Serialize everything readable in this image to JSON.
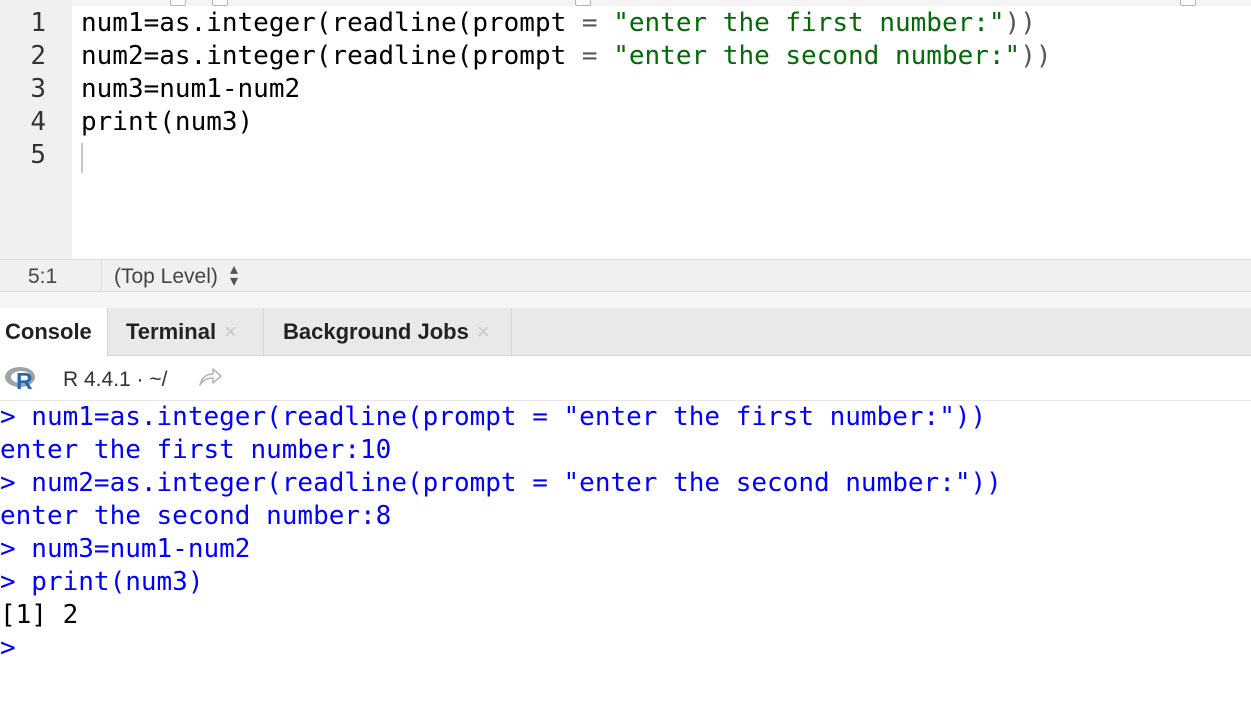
{
  "editor": {
    "line_numbers": [
      "1",
      "2",
      "3",
      "4",
      "5"
    ],
    "lines": [
      {
        "pre": "num1=as.integer(readline(prompt ",
        "eq": "=",
        "sp": " ",
        "str": "\"enter the first number:\"",
        "post": "))"
      },
      {
        "pre": "num2=as.integer(readline(prompt ",
        "eq": "=",
        "sp": " ",
        "str": "\"enter the second number:\"",
        "post": "))"
      },
      {
        "pre": "num3=num1-num2",
        "eq": "",
        "sp": "",
        "str": "",
        "post": ""
      },
      {
        "pre": "print(num3)",
        "eq": "",
        "sp": "",
        "str": "",
        "post": ""
      }
    ]
  },
  "statusbar": {
    "position": "5:1",
    "scope": "(Top Level)"
  },
  "tabs": {
    "console": "Console",
    "terminal": "Terminal",
    "background_jobs": "Background Jobs"
  },
  "console_header": {
    "r_version": "R 4.4.1 · ~/"
  },
  "console": {
    "lines": [
      {
        "text": "> num1=as.integer(readline(prompt = \"enter the first number:\"))",
        "kind": "cmd"
      },
      {
        "text": "enter the first number:10",
        "kind": "cmd"
      },
      {
        "text": "> num2=as.integer(readline(prompt = \"enter the second number:\"))",
        "kind": "cmd"
      },
      {
        "text": "enter the second number:8",
        "kind": "cmd"
      },
      {
        "text": "> num3=num1-num2",
        "kind": "cmd"
      },
      {
        "text": "> print(num3)",
        "kind": "cmd"
      },
      {
        "text": "[1] 2",
        "kind": "out"
      },
      {
        "text": ">",
        "kind": "cmd"
      }
    ]
  },
  "colors": {
    "string": "#036a07",
    "console_command": "#0000ff",
    "gutter_bg": "#f0f0f0"
  },
  "icons": [
    "r-logo-icon",
    "share-arrow-icon",
    "close-icon",
    "sort-arrows-icon"
  ]
}
